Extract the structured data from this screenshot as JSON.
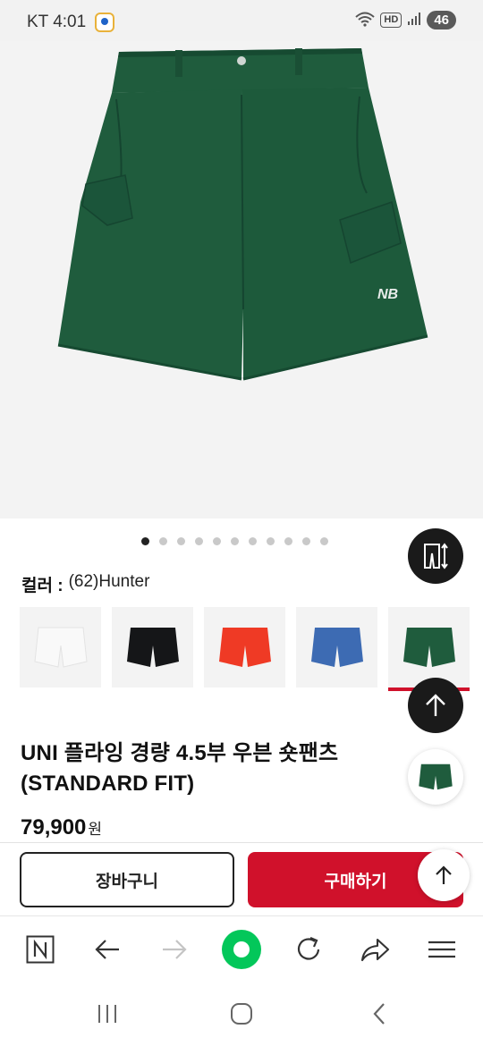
{
  "status_bar": {
    "carrier_time": "KT 4:01",
    "hd_label": "HD",
    "battery": "46"
  },
  "icons": {
    "app_notification": "map-pin-app-icon",
    "wifi": "wifi-icon",
    "signal": "signal-bars-icon",
    "size_guide": "size-guide-icon",
    "arrow_up": "arrow-up-icon",
    "browser_home": "naver-n-icon",
    "back": "arrow-left-icon",
    "forward": "arrow-right-icon",
    "green_dot": "naver-green-dot-icon",
    "refresh": "refresh-icon",
    "share": "share-icon",
    "menu": "hamburger-menu-icon",
    "recent_apps": "recent-apps-icon",
    "home": "home-icon",
    "nav_back": "chevron-left-icon"
  },
  "colors": {
    "accent": "#d0112b",
    "product_green": "#1f5c3d",
    "dark_button": "#1a1a1a"
  },
  "product": {
    "carousel": {
      "dot_count": 11,
      "active_index": 0
    },
    "color_label": "컬러 :",
    "color_value": "(62)Hunter",
    "swatches": [
      {
        "name": "white",
        "color": "#f6f6f6"
      },
      {
        "name": "black",
        "color": "#151618"
      },
      {
        "name": "red",
        "color": "#ef3a25"
      },
      {
        "name": "blue",
        "color": "#3d6bb3"
      },
      {
        "name": "green",
        "color": "#1f5c3d",
        "selected": true
      }
    ],
    "name_line1": "UNI 플라잉 경량 4.5부 우븐 숏팬츠",
    "name_line2": "(STANDARD FIT)",
    "price": "79,900",
    "price_unit": "원"
  },
  "actions": {
    "cart_label": "장바구니",
    "buy_label": "구매하기"
  }
}
